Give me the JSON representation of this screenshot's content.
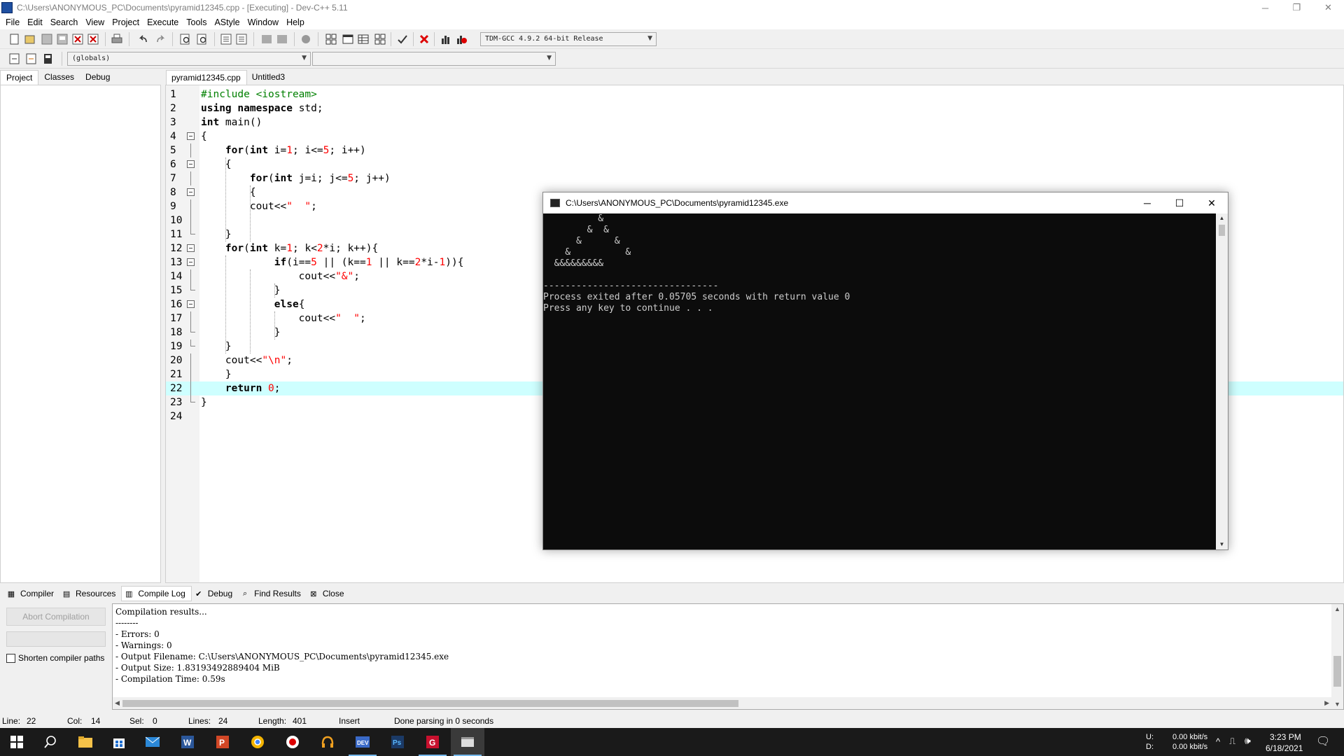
{
  "window": {
    "title": "C:\\Users\\ANONYMOUS_PC\\Documents\\pyramid12345.cpp - [Executing] - Dev-C++ 5.11",
    "min": "─",
    "max": "❐",
    "close": "✕"
  },
  "menu": [
    "File",
    "Edit",
    "Search",
    "View",
    "Project",
    "Execute",
    "Tools",
    "AStyle",
    "Window",
    "Help"
  ],
  "toolbar": {
    "compiler_select": "TDM-GCC 4.9.2 64-bit Release",
    "scope_select": "(globals)",
    "function_select": ""
  },
  "left_tabs": [
    "Project",
    "Classes",
    "Debug"
  ],
  "editor_tabs": [
    "pyramid12345.cpp",
    "Untitled3"
  ],
  "code_lines": [
    "#include <iostream>",
    "using namespace std;",
    "int main()",
    "{",
    "    for(int i=1; i<=5; i++)",
    "    {",
    "        for(int j=i; j<=5; j++)",
    "        {",
    "        cout<<\"  \";",
    "",
    "    }",
    "    for(int k=1; k<2*i; k++){",
    "            if(i==5 || (k==1 || k==2*i-1)){",
    "                cout<<\"&\";",
    "            }",
    "            else{",
    "                cout<<\"  \";",
    "            }",
    "    }",
    "    cout<<\"\\n\";",
    "    }",
    "    return 0;",
    "}",
    ""
  ],
  "console": {
    "title": "C:\\Users\\ANONYMOUS_PC\\Documents\\pyramid12345.exe",
    "output": [
      "          &",
      "        &  &",
      "      &      &",
      "    &          &",
      "  &&&&&&&&&",
      "",
      "--------------------------------",
      "Process exited after 0.05705 seconds with return value 0",
      "Press any key to continue . . ."
    ]
  },
  "bottom_tabs": [
    "Compiler",
    "Resources",
    "Compile Log",
    "Debug",
    "Find Results",
    "Close"
  ],
  "compile": {
    "abort_label": "Abort Compilation",
    "shorten_label": "Shorten compiler paths",
    "log": [
      "Compilation results...",
      "--------",
      "- Errors: 0",
      "- Warnings: 0",
      "- Output Filename: C:\\Users\\ANONYMOUS_PC\\Documents\\pyramid12345.exe",
      "- Output Size: 1.83193492889404 MiB",
      "- Compilation Time: 0.59s"
    ]
  },
  "status": {
    "line_label": "Line:",
    "line": "22",
    "col_label": "Col:",
    "col": "14",
    "sel_label": "Sel:",
    "sel": "0",
    "lines_label": "Lines:",
    "lines": "24",
    "length_label": "Length:",
    "length": "401",
    "mode": "Insert",
    "message": "Done parsing in 0 seconds"
  },
  "tray": {
    "u_label": "U:",
    "d_label": "D:",
    "up_rate": "0.00 kbit/s",
    "down_rate": "0.00 kbit/s",
    "time": "3:23 PM",
    "date": "6/18/2021"
  }
}
